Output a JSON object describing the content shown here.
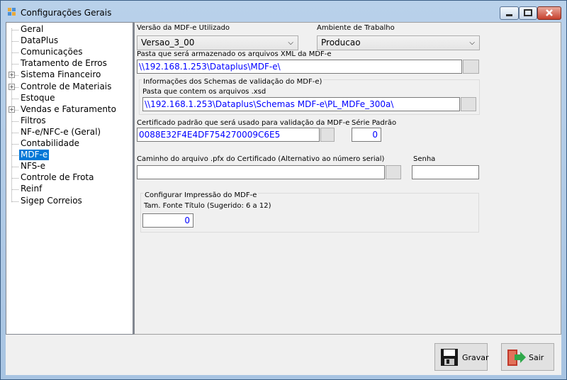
{
  "window": {
    "title": "Configurações Gerais",
    "icon": "app-icon"
  },
  "tree": {
    "items": [
      {
        "label": "Geral",
        "expandable": false
      },
      {
        "label": "DataPlus",
        "expandable": false
      },
      {
        "label": "Comunicações",
        "expandable": false
      },
      {
        "label": "Tratamento de Erros",
        "expandable": false
      },
      {
        "label": "Sistema Financeiro",
        "expandable": true
      },
      {
        "label": "Controle de Materiais",
        "expandable": true
      },
      {
        "label": "Estoque",
        "expandable": false
      },
      {
        "label": "Vendas e Faturamento",
        "expandable": true
      },
      {
        "label": "Filtros",
        "expandable": false
      },
      {
        "label": "NF-e/NFC-e (Geral)",
        "expandable": false
      },
      {
        "label": "Contabilidade",
        "expandable": false
      },
      {
        "label": "MDF-e",
        "expandable": false,
        "selected": true
      },
      {
        "label": "NFS-e",
        "expandable": false
      },
      {
        "label": "Controle de Frota",
        "expandable": false
      },
      {
        "label": "Reinf",
        "expandable": false
      },
      {
        "label": "Sigep Correios",
        "expandable": false
      }
    ]
  },
  "form": {
    "versao_label": "Versão da MDF-e Utilizado",
    "versao_value": "Versao_3_00",
    "ambiente_label": "Ambiente de Trabalho",
    "ambiente_value": "Producao",
    "pasta_xml_label": "Pasta que será armazenado os arquivos XML da MDF-e",
    "pasta_xml_value": "\\\\192.168.1.253\\Dataplus\\MDF-e\\",
    "schemas_group_label": "Informações dos Schemas de validação do MDF-e)",
    "schemas_pasta_label": "Pasta que contem os arquivos .xsd",
    "schemas_pasta_value": "\\\\192.168.1.253\\Dataplus\\Schemas MDF-e\\PL_MDFe_300a\\",
    "certificado_label": "Certificado padrão que será usado para validação da MDF-e",
    "certificado_value": "0088E32F4E4DF754270009C6E5",
    "serie_label": "Série Padrão",
    "serie_value": "0",
    "pfx_label": "Caminho do arquivo .pfx do Certificado (Alternativo ao número serial)",
    "pfx_value": "",
    "senha_label": "Senha",
    "senha_value": "",
    "impressao_group_label": "Configurar Impressão do MDF-e",
    "fonte_label": "Tam. Fonte Título (Sugerido: 6 a 12)",
    "fonte_value": "0"
  },
  "buttons": {
    "gravar": "Gravar",
    "sair": "Sair"
  },
  "colors": {
    "selection": "#0078d7",
    "link_text": "#0000ff",
    "title_bar": "#b9d1ea"
  }
}
